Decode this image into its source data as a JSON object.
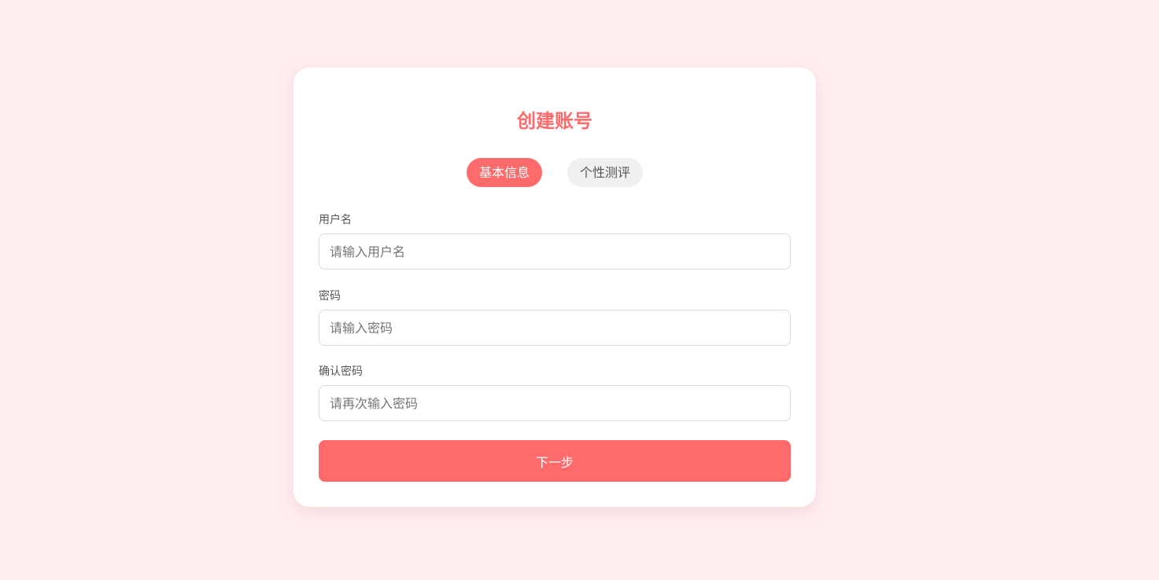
{
  "form": {
    "title": "创建账号",
    "tabs": [
      {
        "label": "基本信息",
        "active": true
      },
      {
        "label": "个性测评",
        "active": false
      }
    ],
    "fields": [
      {
        "label": "用户名",
        "value": "",
        "placeholder": "请输入用户名"
      },
      {
        "label": "密码",
        "value": "",
        "placeholder": "请输入密码"
      },
      {
        "label": "确认密码",
        "value": "",
        "placeholder": "请再次输入密码"
      }
    ],
    "next_label": "下一步"
  },
  "colors": {
    "accent": "#ff6b6b",
    "background": "#ffeef0",
    "card": "#ffffff",
    "tab_inactive": "#f0f0f0"
  }
}
